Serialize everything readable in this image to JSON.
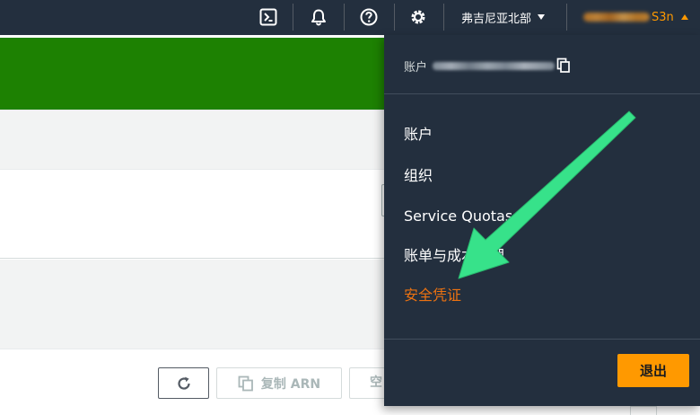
{
  "header": {
    "region_label": "弗吉尼亚北部",
    "user_visible_suffix": "S3n",
    "icons": [
      "cloudshell-icon",
      "bell-icon",
      "help-icon",
      "gear-icon"
    ]
  },
  "toolbar": {
    "copy_arn_label": "复制 ARN",
    "empty_label": "空"
  },
  "account_menu": {
    "account_label": "账户",
    "items": [
      {
        "label": "账户"
      },
      {
        "label": "组织"
      },
      {
        "label": "Service Quotas"
      },
      {
        "label": "账单与成本管理"
      },
      {
        "label": "安全凭证",
        "active": true
      }
    ],
    "logout_label": "退出"
  },
  "colors": {
    "nav_bg": "#232f3e",
    "banner_green": "#1d8102",
    "accent_orange": "#ff9900",
    "active_item": "#ec7211",
    "annotation_arrow": "#37e28a"
  }
}
